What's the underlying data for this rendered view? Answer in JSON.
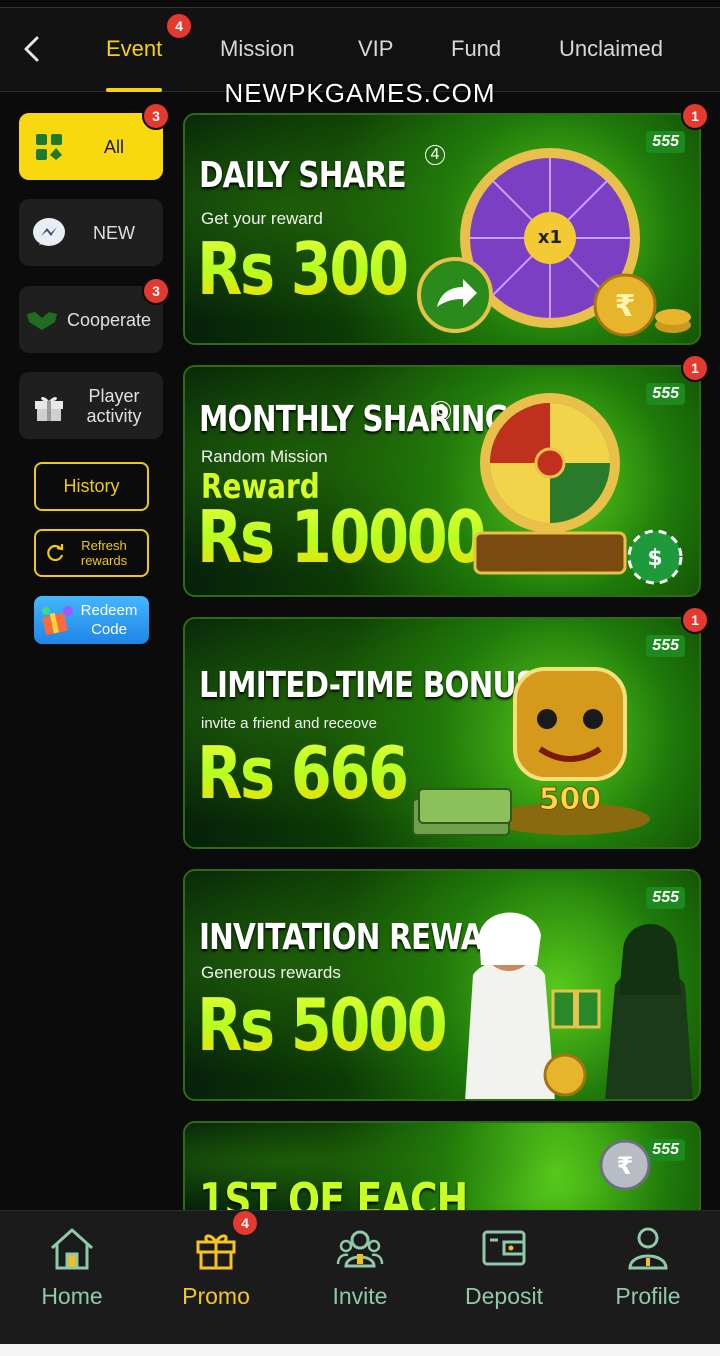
{
  "watermark": "NEWPKGAMES.COM",
  "header": {
    "tabs": [
      {
        "label": "Event",
        "badge": "4",
        "active": true
      },
      {
        "label": "Mission"
      },
      {
        "label": "VIP"
      },
      {
        "label": "Fund"
      },
      {
        "label": "Unclaimed"
      }
    ]
  },
  "sidebar": {
    "items": [
      {
        "label": "All",
        "badge": "3",
        "icon": "grid-cards-icon",
        "active": true
      },
      {
        "label": "NEW",
        "icon": "messenger-icon"
      },
      {
        "label": "Cooperate",
        "badge": "3",
        "icon": "handshake-icon"
      },
      {
        "label": "Player activity",
        "icon": "gift-box-icon"
      }
    ],
    "history_label": "History",
    "refresh_label": "Refresh rewards",
    "redeem_label": "Redeem Code"
  },
  "banners": [
    {
      "title": "DAILY SHARE",
      "number_mark": "4",
      "subtitle": "Get your reward",
      "amount": "Rs 300",
      "logo": "555",
      "badge": "1"
    },
    {
      "title": "MONTHLY SHARING",
      "number_mark": "6",
      "subtitle": "Random Mission",
      "reward_word": "Reward",
      "amount": "Rs 10000",
      "logo": "555",
      "badge": "1"
    },
    {
      "title": "LIMITED-TIME BONUS",
      "subtitle": "invite a friend and receove",
      "amount": "Rs 666",
      "logo": "555",
      "badge": "1"
    },
    {
      "title": "INVITATION REWARD",
      "subtitle": "Generous rewards",
      "amount": "Rs 5000",
      "logo": "555"
    },
    {
      "title": "1ST OF EACH",
      "logo": "555"
    }
  ],
  "bottom_nav": {
    "items": [
      {
        "label": "Home",
        "icon": "home-icon"
      },
      {
        "label": "Promo",
        "icon": "gift-icon",
        "badge": "4",
        "active": true
      },
      {
        "label": "Invite",
        "icon": "users-icon"
      },
      {
        "label": "Deposit",
        "icon": "wallet-icon"
      },
      {
        "label": "Profile",
        "icon": "profile-icon"
      }
    ]
  },
  "colors": {
    "accent": "#f6d20b",
    "badge": "#e3392f",
    "nav_label": "#8fc9a8",
    "promo_label": "#f6c620"
  }
}
